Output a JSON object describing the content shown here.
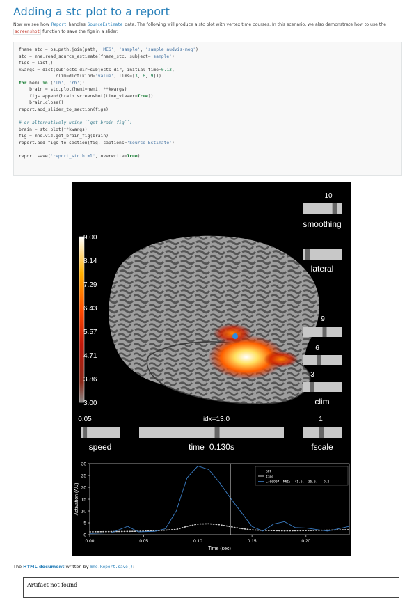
{
  "page": {
    "title": "Adding a stc plot to a report",
    "intro_parts": [
      "Now we see how ",
      "Report",
      " handles ",
      "SourceEstimate",
      " data. The following will produce a stc plot with vertex time courses. In this scenario, we also demonstrate how to use the ",
      "screenshot",
      " function to save the figs in a slider."
    ]
  },
  "code": [
    "fname_stc = os.path.join(path, 'MEG', 'sample', 'sample_audvis-meg')",
    "stc = mne.read_source_estimate(fname_stc, subject='sample')",
    "figs = list()",
    "kwargs = dict(subjects_dir=subjects_dir, initial_time=0.13,",
    "              clim=dict(kind='value', lims=[3, 6, 9]))",
    "for hemi in ('lh', 'rh'):",
    "    brain = stc.plot(hemi=hemi, **kwargs)",
    "    figs.append(brain.screenshot(time_viewer=True))",
    "    brain.close()",
    "report.add_slider_to_section(figs)",
    "",
    "# or alternatively using ``get_brain_fig``:",
    "brain = stc.plot(**kwargs)",
    "fig = mne.viz.get_brain_fig(brain)",
    "report.add_figs_to_section(fig, captions='Source Estimate')",
    "",
    "report.save('report_stc.html', overwrite=True)"
  ],
  "viewer": {
    "colorbar_ticks": [
      "9.00",
      "8.14",
      "7.29",
      "6.43",
      "5.57",
      "4.71",
      "3.86",
      "3.00"
    ],
    "sliders": {
      "smoothing": {
        "label": "smoothing",
        "value": "10",
        "fraction": 0.85
      },
      "orientation": {
        "label": "lateral",
        "fraction": 0.05
      },
      "clim": {
        "label": "clim",
        "values": [
          "9",
          "6",
          "3"
        ],
        "fractions": [
          0.55,
          0.4,
          0.2
        ]
      },
      "speed": {
        "label": "speed",
        "value": "0.05",
        "fraction": 0.08
      },
      "time": {
        "label": "time=0.130s",
        "index_label": "idx=13.0",
        "fraction": 0.54
      },
      "fscale": {
        "label": "fscale",
        "value": "1",
        "fraction": 0.45
      }
    }
  },
  "chart_data": {
    "type": "line",
    "title": "",
    "xlabel": "Time (sec)",
    "ylabel": "Activation (AU)",
    "xlim": [
      0.0,
      0.24
    ],
    "ylim": [
      0,
      30
    ],
    "xticks": [
      "0.00",
      "0.05",
      "0.10",
      "0.15",
      "0.20"
    ],
    "yticks": [
      "0",
      "5",
      "10",
      "15",
      "20",
      "25",
      "30"
    ],
    "time_marker": 0.13,
    "legend": [
      "GFP",
      "time",
      "L:66907  MNI: -41.6, -35.5,   9.2"
    ],
    "series": [
      {
        "name": "GFP",
        "style": "dotted",
        "color": "#cccccc",
        "x": [
          0.0,
          0.02,
          0.04,
          0.06,
          0.08,
          0.09,
          0.1,
          0.11,
          0.12,
          0.13,
          0.14,
          0.15,
          0.16,
          0.18,
          0.2,
          0.22,
          0.24
        ],
        "y": [
          1.2,
          1.3,
          1.4,
          1.6,
          2.2,
          3.5,
          4.5,
          4.6,
          4.2,
          3.4,
          2.6,
          2.0,
          1.8,
          1.6,
          1.7,
          1.9,
          2.1
        ]
      },
      {
        "name": "L:66907  MNI: -41.6, -35.5,   9.2",
        "style": "solid",
        "color": "#3b7dc4",
        "x": [
          0.0,
          0.02,
          0.035,
          0.045,
          0.06,
          0.07,
          0.08,
          0.09,
          0.1,
          0.11,
          0.12,
          0.13,
          0.14,
          0.15,
          0.16,
          0.17,
          0.18,
          0.19,
          0.2,
          0.22,
          0.24
        ],
        "y": [
          0.5,
          0.8,
          3.5,
          1.2,
          1.4,
          2.5,
          10.0,
          24.0,
          29.0,
          27.5,
          22.0,
          15.5,
          9.5,
          3.5,
          1.5,
          4.5,
          5.5,
          3.0,
          2.8,
          1.5,
          3.5
        ]
      }
    ]
  },
  "footer": {
    "text_prefix": "The ",
    "link_label": "HTML document",
    "text_mid": " written by ",
    "code_label": "mne.Report.save()",
    "text_suffix": ":",
    "artifact_text": "Artifact not found"
  }
}
